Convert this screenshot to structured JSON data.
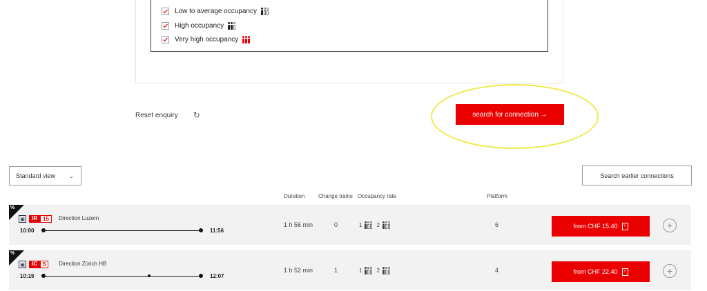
{
  "occupancy_filters": [
    {
      "label": "Low to average occupancy",
      "checked": true,
      "level": 1
    },
    {
      "label": "High occupancy",
      "checked": true,
      "level": 2
    },
    {
      "label": "Very high occupancy",
      "checked": true,
      "level": 3
    }
  ],
  "actions": {
    "reset_label": "Reset enquiry",
    "search_label": "search for connection →"
  },
  "view_select": {
    "selected": "Standard view"
  },
  "earlier_label": "Search earlier connections",
  "columns": {
    "duration": "Duration",
    "change": "Change trains",
    "occupancy": "Occupancy rate",
    "platform": "Platform"
  },
  "connections": [
    {
      "category": "IR",
      "line": "15",
      "direction": "Direction Luzern",
      "dep": "10:00",
      "arr": "11:56",
      "duration": "1 h 56 min",
      "changes": "0",
      "class1": "1",
      "class2": "2",
      "platform": "6",
      "fare": "from CHF 15.40",
      "stops": 0
    },
    {
      "category": "IC",
      "line": "5",
      "direction": "Direction Zürich HB",
      "dep": "10:15",
      "arr": "12:07",
      "duration": "1 h 52 min",
      "changes": "1",
      "class1": "1",
      "class2": "2",
      "platform": "4",
      "fare": "from CHF 22.40",
      "stops": 1
    }
  ],
  "colors": {
    "accent": "#eb0000",
    "highlight": "#f0e94a"
  }
}
